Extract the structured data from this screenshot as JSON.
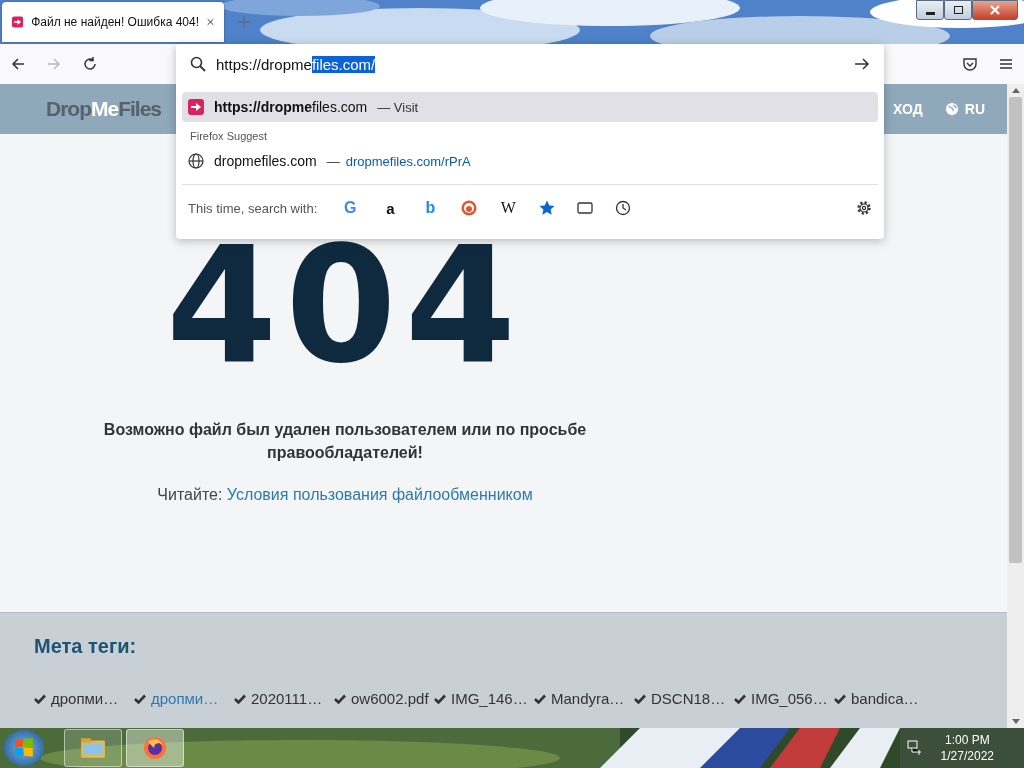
{
  "tab": {
    "title": "Файл не найден! Ошибка 404!",
    "selected": true
  },
  "urlbar": {
    "typed": "https://dropme",
    "autofill": "files.com/"
  },
  "suggestions": [
    {
      "kind": "visit",
      "text": "**https://dropme**files.com",
      "action": "— Visit",
      "selected": true
    },
    {
      "kind": "suggest",
      "text": "dropmefiles.com",
      "action": "—",
      "link": "dropmefiles.com/rPrA",
      "selected": false
    }
  ],
  "suggest_heading": "Firefox Suggest",
  "search_with": {
    "label": "This time, search with:",
    "engines": [
      {
        "kind": "google",
        "glyph": "G"
      },
      {
        "kind": "amazon",
        "glyph": "a"
      },
      {
        "kind": "bing",
        "glyph": "b"
      },
      {
        "kind": "duck"
      },
      {
        "kind": "wiki",
        "glyph": "W"
      },
      {
        "kind": "bookmarks"
      },
      {
        "kind": "tabs"
      },
      {
        "kind": "history"
      }
    ]
  },
  "site_header": {
    "logo": [
      "Drop",
      "Me",
      "Files"
    ],
    "login": "ХОД",
    "language": "RU"
  },
  "error": {
    "code": "404",
    "message": "Возможно файл был удален пользователем или по просьбе правообладателей!",
    "read_label": "Читайте:",
    "read_link": "Условия пользования файлообменником"
  },
  "meta": {
    "title": "Мета теги:",
    "tags": [
      {
        "text": "дропми…",
        "active": false
      },
      {
        "text": "дропми…",
        "active": true
      },
      {
        "text": "2020111…",
        "active": false
      },
      {
        "text": "ow6002.pdf",
        "active": false
      },
      {
        "text": "IMG_146…",
        "active": false
      },
      {
        "text": "Mandyra…",
        "active": false
      },
      {
        "text": "DSCN18…",
        "active": false
      },
      {
        "text": "IMG_056…",
        "active": false
      },
      {
        "text": "bandica…",
        "active": false
      }
    ]
  },
  "taskbar": {
    "apps": [
      {
        "kind": "explorer",
        "selected": false
      },
      {
        "kind": "firefox",
        "selected": true
      }
    ],
    "time": "1:00 PM",
    "date": "1/27/2022"
  }
}
